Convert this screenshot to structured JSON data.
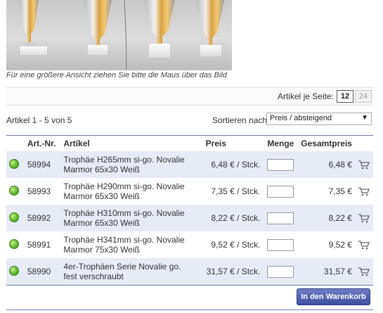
{
  "image_hint": "Für eine größere Ansicht ziehen Sie bitte die Maus über das Bild",
  "per_page": {
    "label": "Artikel je Seite:",
    "options": [
      "12",
      "24"
    ],
    "selected": "12"
  },
  "listing": {
    "count_text": "Artikel 1 - 5 von 5",
    "sort_label": "Sortieren nach:",
    "sort_value": "Preis / absteigend"
  },
  "table": {
    "headers": {
      "art_nr": "Art.-Nr.",
      "artikel": "Artikel",
      "preis": "Preis",
      "menge": "Menge",
      "gesamt": "Gesamtpreis"
    },
    "rows": [
      {
        "art_nr": "58994",
        "line1": "Trophäe H265mm si-go. Novalie",
        "line2": "Marmor 65x30 Weiß",
        "price": "6,48 € / Stck.",
        "total": "6,48 €"
      },
      {
        "art_nr": "58993",
        "line1": "Trophäe H290mm si-go. Novalie",
        "line2": "Marmor 65x30 Weiß",
        "price": "7,35 € / Stck.",
        "total": "7,35 €"
      },
      {
        "art_nr": "58992",
        "line1": "Trophäe H310mm si-go. Novalie",
        "line2": "Marmor 65x30 Weiß",
        "price": "8,22 € / Stck.",
        "total": "8,22 €"
      },
      {
        "art_nr": "58991",
        "line1": "Trophäe H341mm si-go. Novalie",
        "line2": "Marmor 75x30 Weiß",
        "price": "9,52 € / Stck.",
        "total": "9,52 €"
      },
      {
        "art_nr": "58990",
        "line1": "4er-Trophäen Serie Novalie go.",
        "line2": "fest verschraubt",
        "price": "31,57 € / Stck.",
        "total": "31,57 €"
      }
    ]
  },
  "cart_button_label": "In den Warenkorb",
  "colors": {
    "accent": "#3e4f9e",
    "row_alt": "#e6ebf6",
    "availability": "#6cc43a"
  }
}
